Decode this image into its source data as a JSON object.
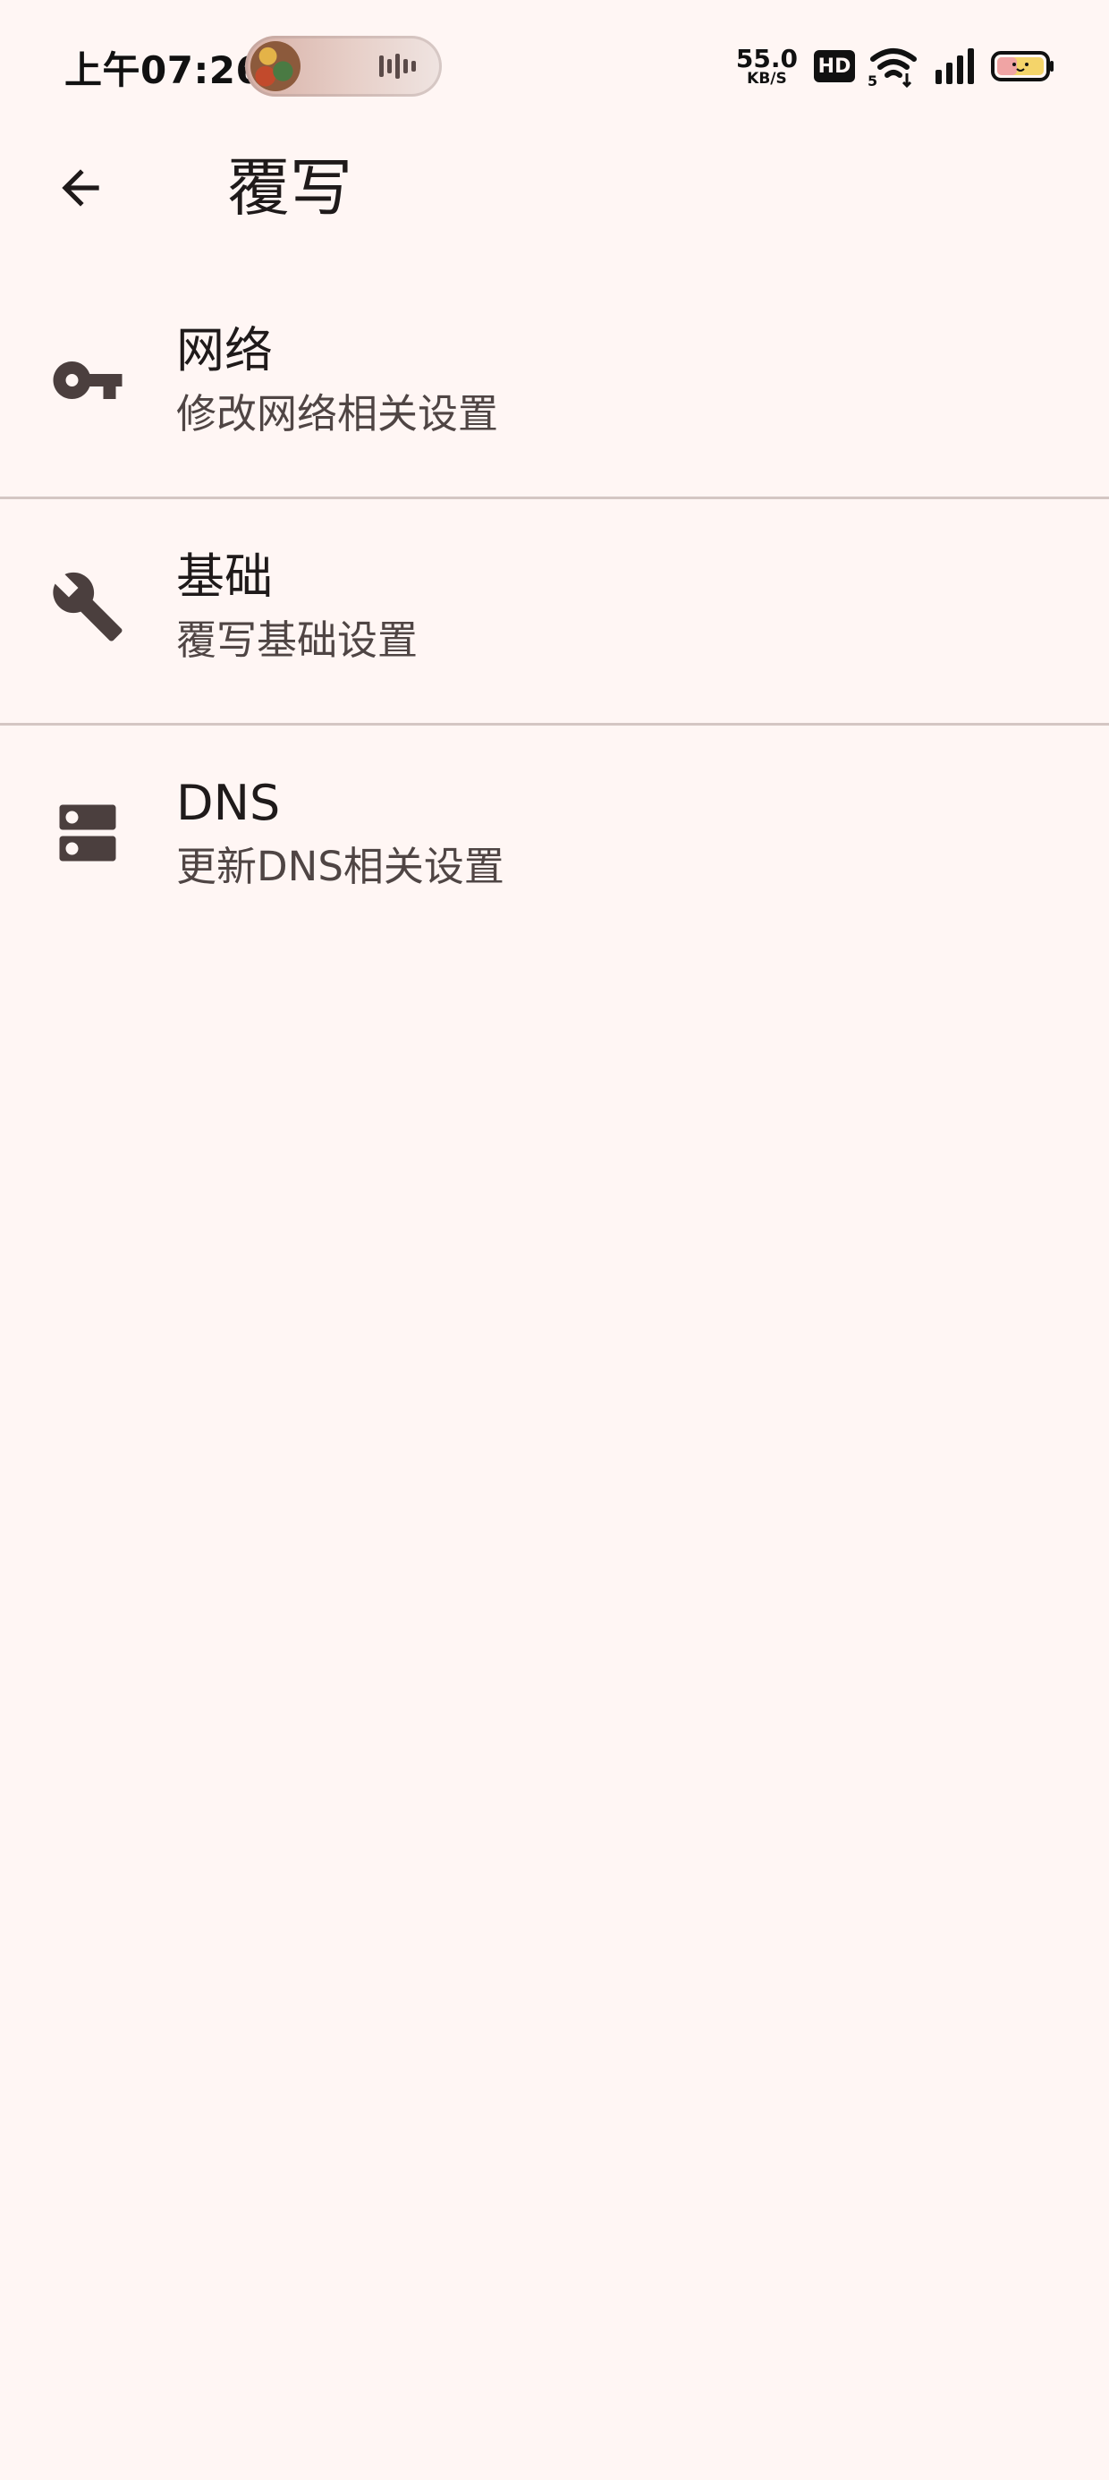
{
  "status_bar": {
    "time": "上午07:26",
    "net_speed_value": "55.0",
    "net_speed_unit": "KB/S",
    "hd_badge": "HD",
    "wifi_label": "5",
    "icons": [
      "music-wave-icon",
      "hd-icon",
      "wifi-icon",
      "signal-icon",
      "battery-icon"
    ]
  },
  "app_bar": {
    "title": "覆写",
    "back_icon": "arrow-back-icon"
  },
  "settings": [
    {
      "title": "网络",
      "subtitle": "修改网络相关设置",
      "icon": "key-icon"
    },
    {
      "title": "基础",
      "subtitle": "覆写基础设置",
      "icon": "wrench-icon"
    },
    {
      "title": "DNS",
      "subtitle": "更新DNS相关设置",
      "icon": "dns-icon"
    }
  ],
  "colors": {
    "background": "#fff6f4",
    "icon": "#4b3f3e",
    "text_primary": "#1f1a1a",
    "text_secondary": "#4f4544",
    "divider": "#d4c6c3"
  }
}
